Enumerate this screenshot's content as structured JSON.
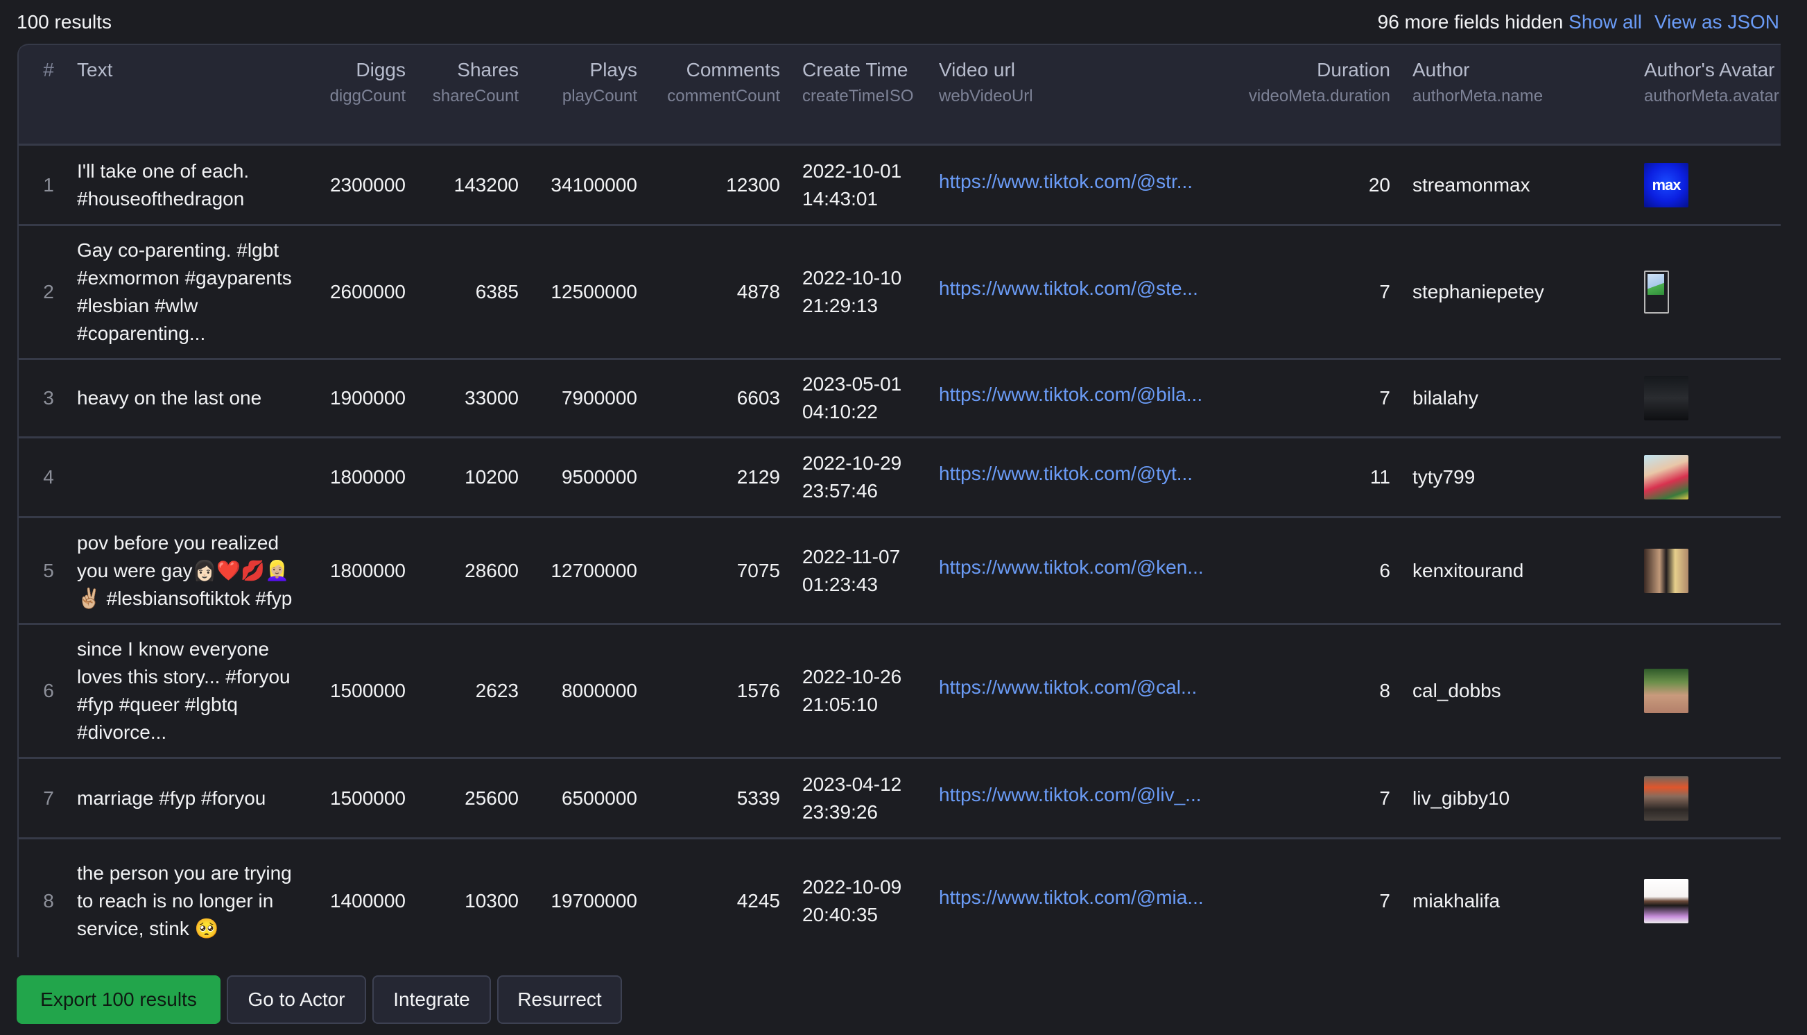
{
  "topbar": {
    "results_count": "100 results",
    "hidden_fields": "96 more fields hidden",
    "show_all": "Show all",
    "view_json": "View as JSON"
  },
  "columns": [
    {
      "key": "index",
      "title": "#",
      "sub": ""
    },
    {
      "key": "text",
      "title": "Text",
      "sub": ""
    },
    {
      "key": "diggs",
      "title": "Diggs",
      "sub": "diggCount"
    },
    {
      "key": "shares",
      "title": "Shares",
      "sub": "shareCount"
    },
    {
      "key": "plays",
      "title": "Plays",
      "sub": "playCount"
    },
    {
      "key": "comments",
      "title": "Comments",
      "sub": "commentCount"
    },
    {
      "key": "create_time",
      "title": "Create Time",
      "sub": "createTimeISO"
    },
    {
      "key": "video_url",
      "title": "Video url",
      "sub": "webVideoUrl"
    },
    {
      "key": "duration",
      "title": "Duration",
      "sub": "videoMeta.duration"
    },
    {
      "key": "author",
      "title": "Author",
      "sub": "authorMeta.name"
    },
    {
      "key": "avatar",
      "title": "Author's Avatar",
      "sub": "authorMeta.avatar"
    }
  ],
  "rows": [
    {
      "index": "1",
      "text": "I'll take one of each. #houseofthedragon",
      "diggs": "2300000",
      "shares": "143200",
      "plays": "34100000",
      "comments": "12300",
      "date": "2022-10-01",
      "time": "14:43:01",
      "video_url": "https://www.tiktok.com/@str...",
      "duration": "20",
      "author": "streamonmax",
      "avatar": "max-logo",
      "avatar_text": "max"
    },
    {
      "index": "2",
      "text": "Gay co-parenting. #lgbt #exmormon #gayparents #lesbian #wlw #coparenting...",
      "diggs": "2600000",
      "shares": "6385",
      "plays": "12500000",
      "comments": "4878",
      "date": "2022-10-10",
      "time": "21:29:13",
      "video_url": "https://www.tiktok.com/@ste...",
      "duration": "7",
      "author": "stephaniepetey",
      "avatar": "broken-image",
      "avatar_text": ""
    },
    {
      "index": "3",
      "text": "heavy on the last one",
      "diggs": "1900000",
      "shares": "33000",
      "plays": "7900000",
      "comments": "6603",
      "date": "2023-05-01",
      "time": "04:10:22",
      "video_url": "https://www.tiktok.com/@bila...",
      "duration": "7",
      "author": "bilalahy",
      "avatar": "photo",
      "avatar_text": ""
    },
    {
      "index": "4",
      "text": "",
      "diggs": "1800000",
      "shares": "10200",
      "plays": "9500000",
      "comments": "2129",
      "date": "2022-10-29",
      "time": "23:57:46",
      "video_url": "https://www.tiktok.com/@tyt...",
      "duration": "11",
      "author": "tyty799",
      "avatar": "photo",
      "avatar_text": ""
    },
    {
      "index": "5",
      "text": "pov before you realized you were gay👩🏻❤️💋👱🏼‍♀️✌🏼 #lesbiansoftiktok #fyp",
      "diggs": "1800000",
      "shares": "28600",
      "plays": "12700000",
      "comments": "7075",
      "date": "2022-11-07",
      "time": "01:23:43",
      "video_url": "https://www.tiktok.com/@ken...",
      "duration": "6",
      "author": "kenxitourand",
      "avatar": "photo",
      "avatar_text": ""
    },
    {
      "index": "6",
      "text": "since I know everyone loves this story... #foryou #fyp #queer #lgbtq #divorce...",
      "diggs": "1500000",
      "shares": "2623",
      "plays": "8000000",
      "comments": "1576",
      "date": "2022-10-26",
      "time": "21:05:10",
      "video_url": "https://www.tiktok.com/@cal...",
      "duration": "8",
      "author": "cal_dobbs",
      "avatar": "photo",
      "avatar_text": ""
    },
    {
      "index": "7",
      "text": "marriage #fyp #foryou",
      "diggs": "1500000",
      "shares": "25600",
      "plays": "6500000",
      "comments": "5339",
      "date": "2023-04-12",
      "time": "23:39:26",
      "video_url": "https://www.tiktok.com/@liv_...",
      "duration": "7",
      "author": "liv_gibby10",
      "avatar": "photo",
      "avatar_text": ""
    },
    {
      "index": "8",
      "text": "the person you are trying to reach is no longer in service, stink 🥺",
      "diggs": "1400000",
      "shares": "10300",
      "plays": "19700000",
      "comments": "4245",
      "date": "2022-10-09",
      "time": "20:40:35",
      "video_url": "https://www.tiktok.com/@mia...",
      "duration": "7",
      "author": "miakhalifa",
      "avatar": "photo",
      "avatar_text": ""
    }
  ],
  "actions": {
    "export": "Export 100 results",
    "go_to_actor": "Go to Actor",
    "integrate": "Integrate",
    "resurrect": "Resurrect"
  },
  "colors": {
    "accent_link": "#6b9cf7",
    "primary_button": "#22a54b",
    "background": "#1c1d22",
    "header_background": "#252733"
  }
}
